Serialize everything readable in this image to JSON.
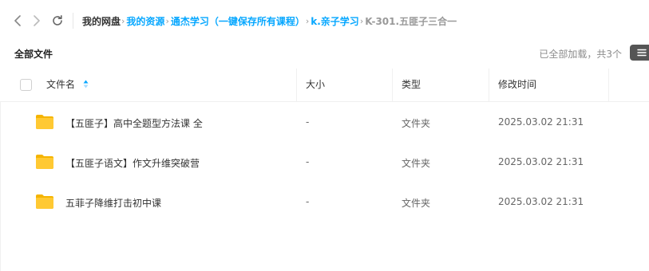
{
  "nav": {
    "back_icon": "chevron-left-icon",
    "forward_icon": "chevron-right-icon",
    "refresh_icon": "refresh-icon"
  },
  "breadcrumb": {
    "items": [
      {
        "label": "我的网盘",
        "kind": "root"
      },
      {
        "label": "我的资源",
        "kind": "link"
      },
      {
        "label": "通杰学习（一键保存所有课程）",
        "kind": "link"
      },
      {
        "label": "k.亲子学习",
        "kind": "link"
      },
      {
        "label": "K-301.五匪子三合一",
        "kind": "current"
      }
    ],
    "separator": "›"
  },
  "toolbar": {
    "all_files_label": "全部文件",
    "loaded_text": "已全部加载，共3个",
    "menu_icon": "list-menu-icon"
  },
  "table": {
    "headers": {
      "name": "文件名",
      "size": "大小",
      "type": "类型",
      "modified": "修改时间"
    },
    "rows": [
      {
        "name": "【五匪子】高中全题型方法课 全",
        "size": "-",
        "type": "文件夹",
        "modified": "2025.03.02 21:31",
        "icon": "folder-icon"
      },
      {
        "name": "【五匪子语文】作文升维突破营",
        "size": "-",
        "type": "文件夹",
        "modified": "2025.03.02 21:31",
        "icon": "folder-icon"
      },
      {
        "name": "五菲子降维打击初中课",
        "size": "-",
        "type": "文件夹",
        "modified": "2025.03.02 21:31",
        "icon": "folder-icon"
      }
    ]
  },
  "colors": {
    "accent": "#06a7ff",
    "folder": "#ffc933",
    "folder_back": "#f5b400"
  }
}
